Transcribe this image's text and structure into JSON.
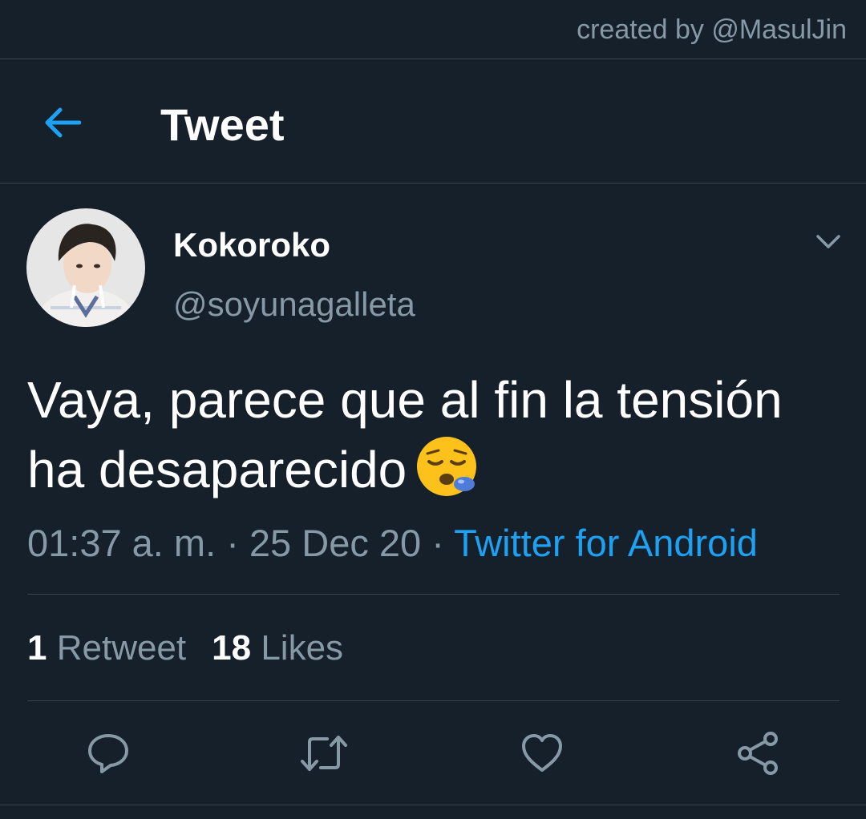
{
  "watermark": {
    "credit": "created by @MasulJin"
  },
  "header": {
    "title": "Tweet",
    "back_icon": "arrow-left-icon"
  },
  "author": {
    "display_name": "Kokoroko",
    "handle": "@soyunagalleta",
    "avatar": "avatar-photo",
    "menu_icon": "chevron-down-icon"
  },
  "tweet": {
    "text_line1": "Vaya, parece que al fin la tensión",
    "text_line2": "ha desaparecido",
    "emoji": "sleepy-face-emoji",
    "time": "01:37 a. m.",
    "separator": "·",
    "date": "25 Dec 20",
    "source": "Twitter for Android"
  },
  "stats": {
    "retweets_count": "1",
    "retweets_label": "Retweet",
    "likes_count": "18",
    "likes_label": "Likes"
  },
  "actions": [
    {
      "name": "reply",
      "icon": "comment-icon"
    },
    {
      "name": "retweet",
      "icon": "retweet-icon"
    },
    {
      "name": "like",
      "icon": "heart-icon"
    },
    {
      "name": "share",
      "icon": "share-icon"
    }
  ],
  "colors": {
    "background": "#15202b",
    "divider": "#38444d",
    "secondary_text": "#8899a6",
    "accent": "#1da1f2",
    "primary_text": "#ffffff"
  }
}
